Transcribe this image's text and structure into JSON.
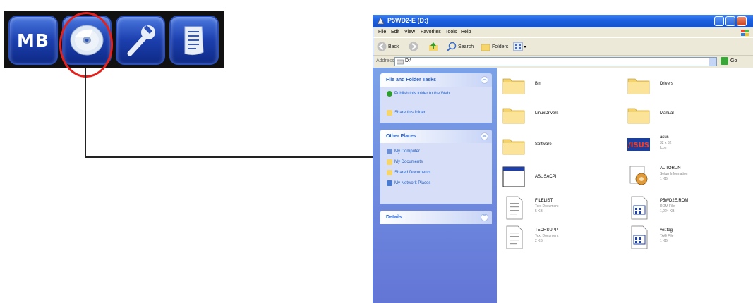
{
  "toolbar": {
    "buttons": [
      {
        "id": "mb",
        "label": "MB",
        "icon": "mb-text"
      },
      {
        "id": "cd",
        "icon": "cd-disc-icon"
      },
      {
        "id": "tools",
        "icon": "wrench-icon"
      },
      {
        "id": "docs",
        "icon": "document-icon"
      }
    ],
    "highlight_color": "#e5211d"
  },
  "window": {
    "title": "P5WD2-E (D:)",
    "menus": [
      "File",
      "Edit",
      "View",
      "Favorites",
      "Tools",
      "Help"
    ],
    "toolbar": {
      "back": "Back",
      "search": "Search",
      "folders": "Folders"
    },
    "address": {
      "label": "Address",
      "value": "D:\\",
      "go": "Go"
    }
  },
  "task_pane": {
    "file_folder_tasks": {
      "title": "File and Folder Tasks",
      "items": [
        "Publish this folder to the Web",
        "Share this folder"
      ]
    },
    "other_places": {
      "title": "Other Places",
      "items": [
        "My Computer",
        "My Documents",
        "Shared Documents",
        "My Network Places"
      ]
    },
    "details": {
      "title": "Details"
    }
  },
  "files": [
    {
      "name": "Bin",
      "type": "folder"
    },
    {
      "name": "Drivers",
      "type": "folder"
    },
    {
      "name": "LinuxDrivers",
      "type": "folder"
    },
    {
      "name": "Manual",
      "type": "folder"
    },
    {
      "name": "Software",
      "type": "folder"
    },
    {
      "name": "asus",
      "type": "image",
      "sub1": "32 x 32",
      "sub2": "Icon"
    },
    {
      "name": "ASUSACPI",
      "type": "window"
    },
    {
      "name": "AUTORUN",
      "type": "setup",
      "sub1": "Setup Information",
      "sub2": "1 KB"
    },
    {
      "name": "FILELIST",
      "type": "text",
      "sub1": "Text Document",
      "sub2": "5 KB"
    },
    {
      "name": "P5WD2E.ROM",
      "type": "rom",
      "sub1": "ROM File",
      "sub2": "1,024 KB"
    },
    {
      "name": "TECHSUPP",
      "type": "text",
      "sub1": "Text Document",
      "sub2": "2 KB"
    },
    {
      "name": "ver.tag",
      "type": "tag",
      "sub1": "TAG File",
      "sub2": "1 KB"
    }
  ]
}
